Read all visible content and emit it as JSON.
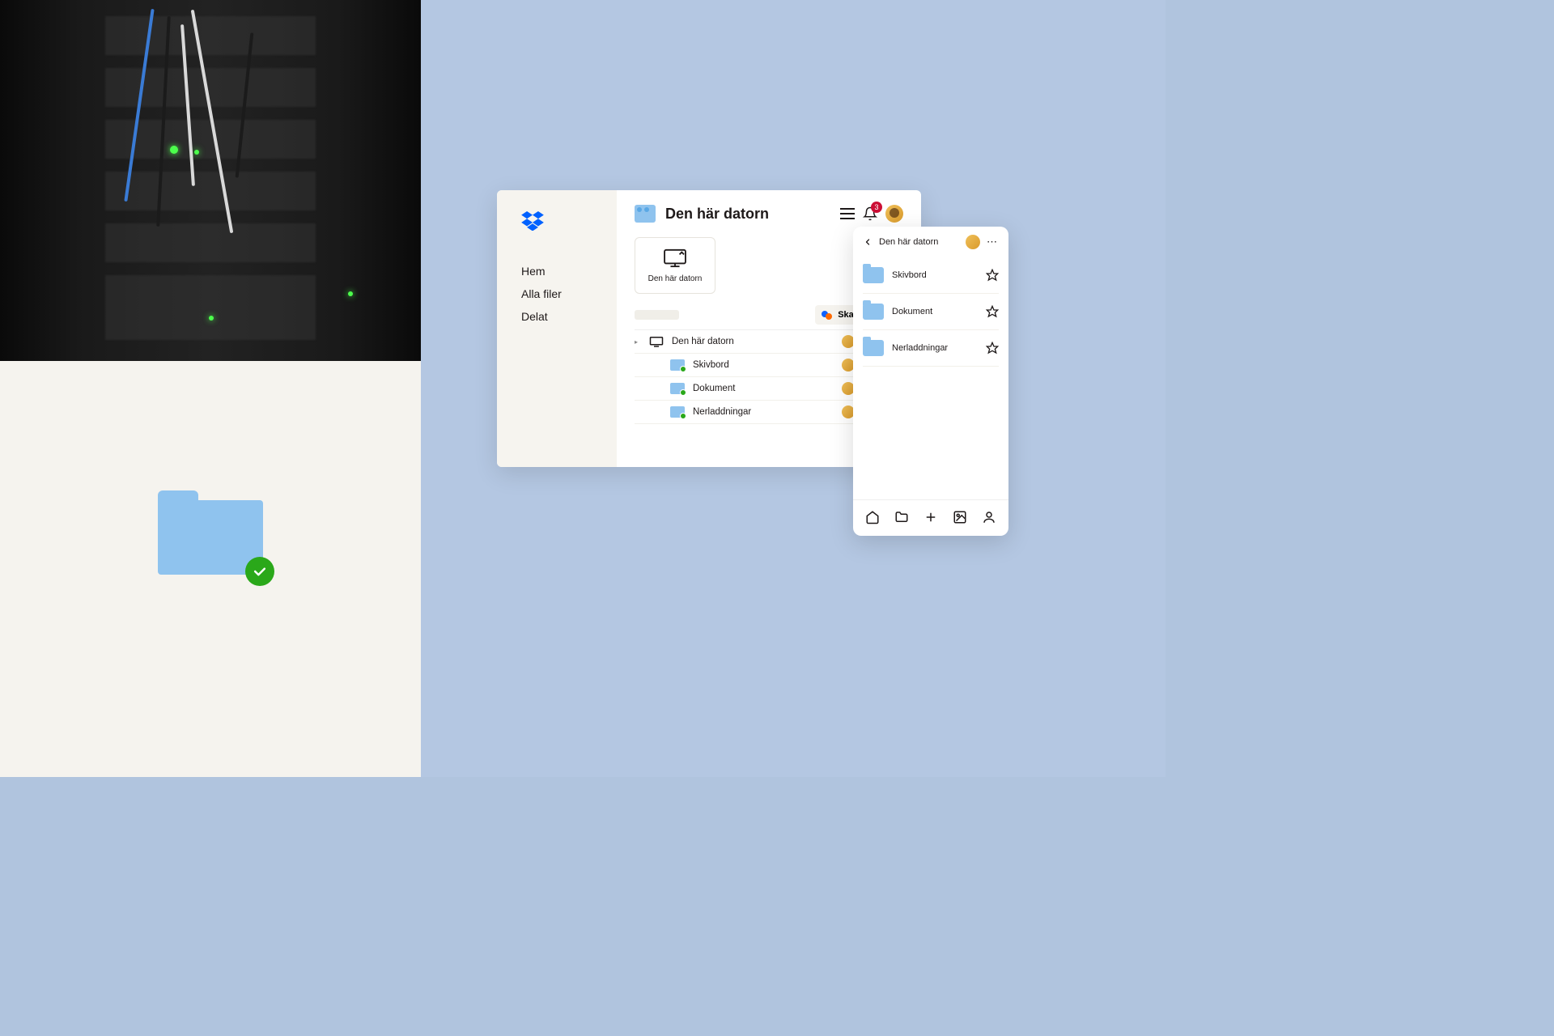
{
  "colors": {
    "accent_blue": "#8fc3ee",
    "brand_blue": "#0061ff",
    "success_green": "#2aa81a",
    "badge_red": "#cc0f35"
  },
  "desktop": {
    "sidebar": {
      "items": [
        "Hem",
        "Alla filer",
        "Delat"
      ]
    },
    "header": {
      "title": "Den här datorn",
      "notification_count": "3"
    },
    "computer_card": {
      "label": "Den här datorn"
    },
    "toolbar": {
      "create_label": "Skapa"
    },
    "file_tree": {
      "root": {
        "name": "Den här datorn"
      },
      "children": [
        {
          "name": "Skivbord"
        },
        {
          "name": "Dokument"
        },
        {
          "name": "Nerladdningar"
        }
      ]
    }
  },
  "mobile": {
    "header": {
      "title": "Den här datorn"
    },
    "items": [
      {
        "name": "Skivbord"
      },
      {
        "name": "Dokument"
      },
      {
        "name": "Nerladdningar"
      }
    ]
  }
}
